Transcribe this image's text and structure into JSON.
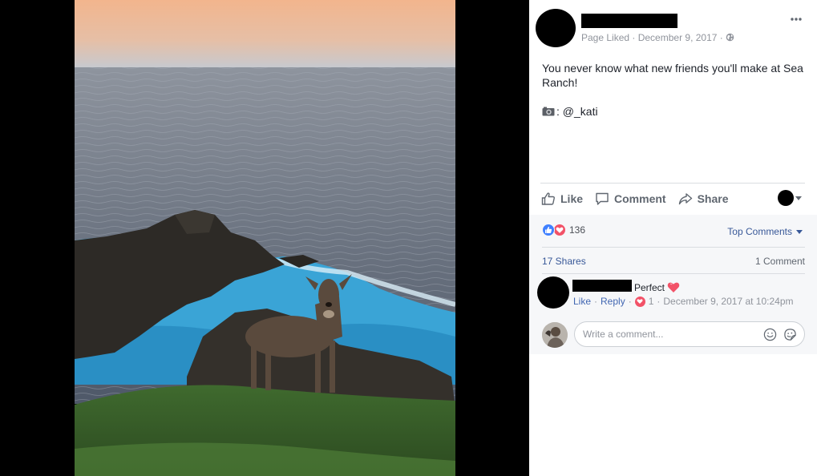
{
  "post": {
    "meta_status": "Page Liked",
    "meta_sep1": " · ",
    "meta_date": "December 9, 2017",
    "meta_sep2": " · ",
    "text_line": "You never know what new friends you'll make at Sea Ranch!",
    "credit": ": @_kati"
  },
  "actions": {
    "like": "Like",
    "comment": "Comment",
    "share": "Share"
  },
  "stats": {
    "reaction_count": "136",
    "top_comments": "Top Comments",
    "shares": "17 Shares",
    "comments": "1 Comment"
  },
  "comment": {
    "text": "Perfect",
    "like": "Like",
    "reply": "Reply",
    "sep": " · ",
    "love_count": "1",
    "timestamp": "December 9, 2017 at 10:24pm"
  },
  "composer": {
    "placeholder": "Write a comment..."
  },
  "colors": {
    "link": "#385898",
    "like_reaction": "#4080ff",
    "love_reaction": "#f25268"
  },
  "icons": [
    "more-icon",
    "globe-icon",
    "camera-icon",
    "thumbs-up-icon",
    "comment-icon",
    "share-icon",
    "emoji-icon",
    "sticker-icon",
    "heart-icon"
  ]
}
